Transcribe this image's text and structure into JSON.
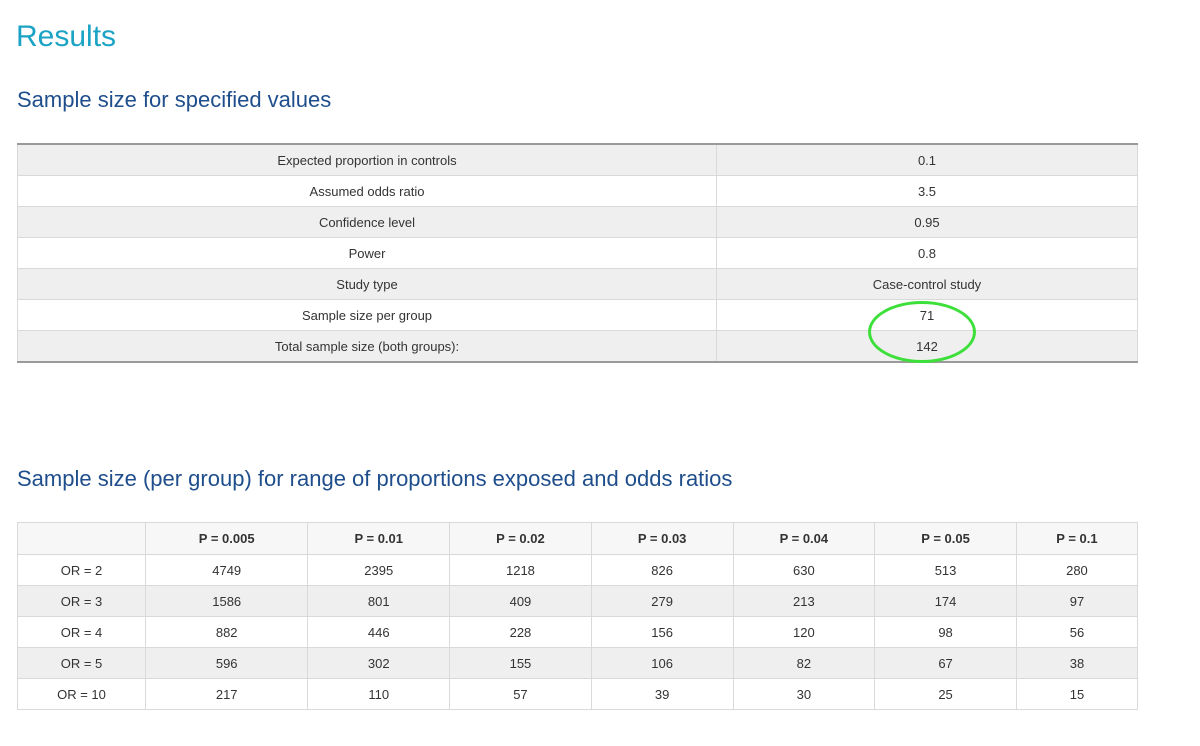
{
  "page": {
    "title": "Results",
    "section1_title": "Sample size for specified values",
    "section2_title": "Sample size (per group) for range of proportions exposed and odds ratios"
  },
  "summary": {
    "rows": [
      {
        "label": "Expected proportion in controls",
        "value": "0.1"
      },
      {
        "label": "Assumed odds ratio",
        "value": "3.5"
      },
      {
        "label": "Confidence level",
        "value": "0.95"
      },
      {
        "label": "Power",
        "value": "0.8"
      },
      {
        "label": "Study type",
        "value": "Case-control study"
      },
      {
        "label": "Sample size per group",
        "value": "71"
      },
      {
        "label": "Total sample size (both groups):",
        "value": "142"
      }
    ]
  },
  "range_table": {
    "headers": [
      "",
      "P = 0.005",
      "P = 0.01",
      "P = 0.02",
      "P = 0.03",
      "P = 0.04",
      "P = 0.05",
      "P = 0.1"
    ],
    "rows": [
      [
        "OR = 2",
        "4749",
        "2395",
        "1218",
        "826",
        "630",
        "513",
        "280"
      ],
      [
        "OR = 3",
        "1586",
        "801",
        "409",
        "279",
        "213",
        "174",
        "97"
      ],
      [
        "OR = 4",
        "882",
        "446",
        "228",
        "156",
        "120",
        "98",
        "56"
      ],
      [
        "OR = 5",
        "596",
        "302",
        "155",
        "106",
        "82",
        "67",
        "38"
      ],
      [
        "OR = 10",
        "217",
        "110",
        "57",
        "39",
        "30",
        "25",
        "15"
      ]
    ]
  },
  "colors": {
    "results_title": "#1aa3c4",
    "section_title": "#1f4e8c",
    "highlight": "#3de03a"
  }
}
